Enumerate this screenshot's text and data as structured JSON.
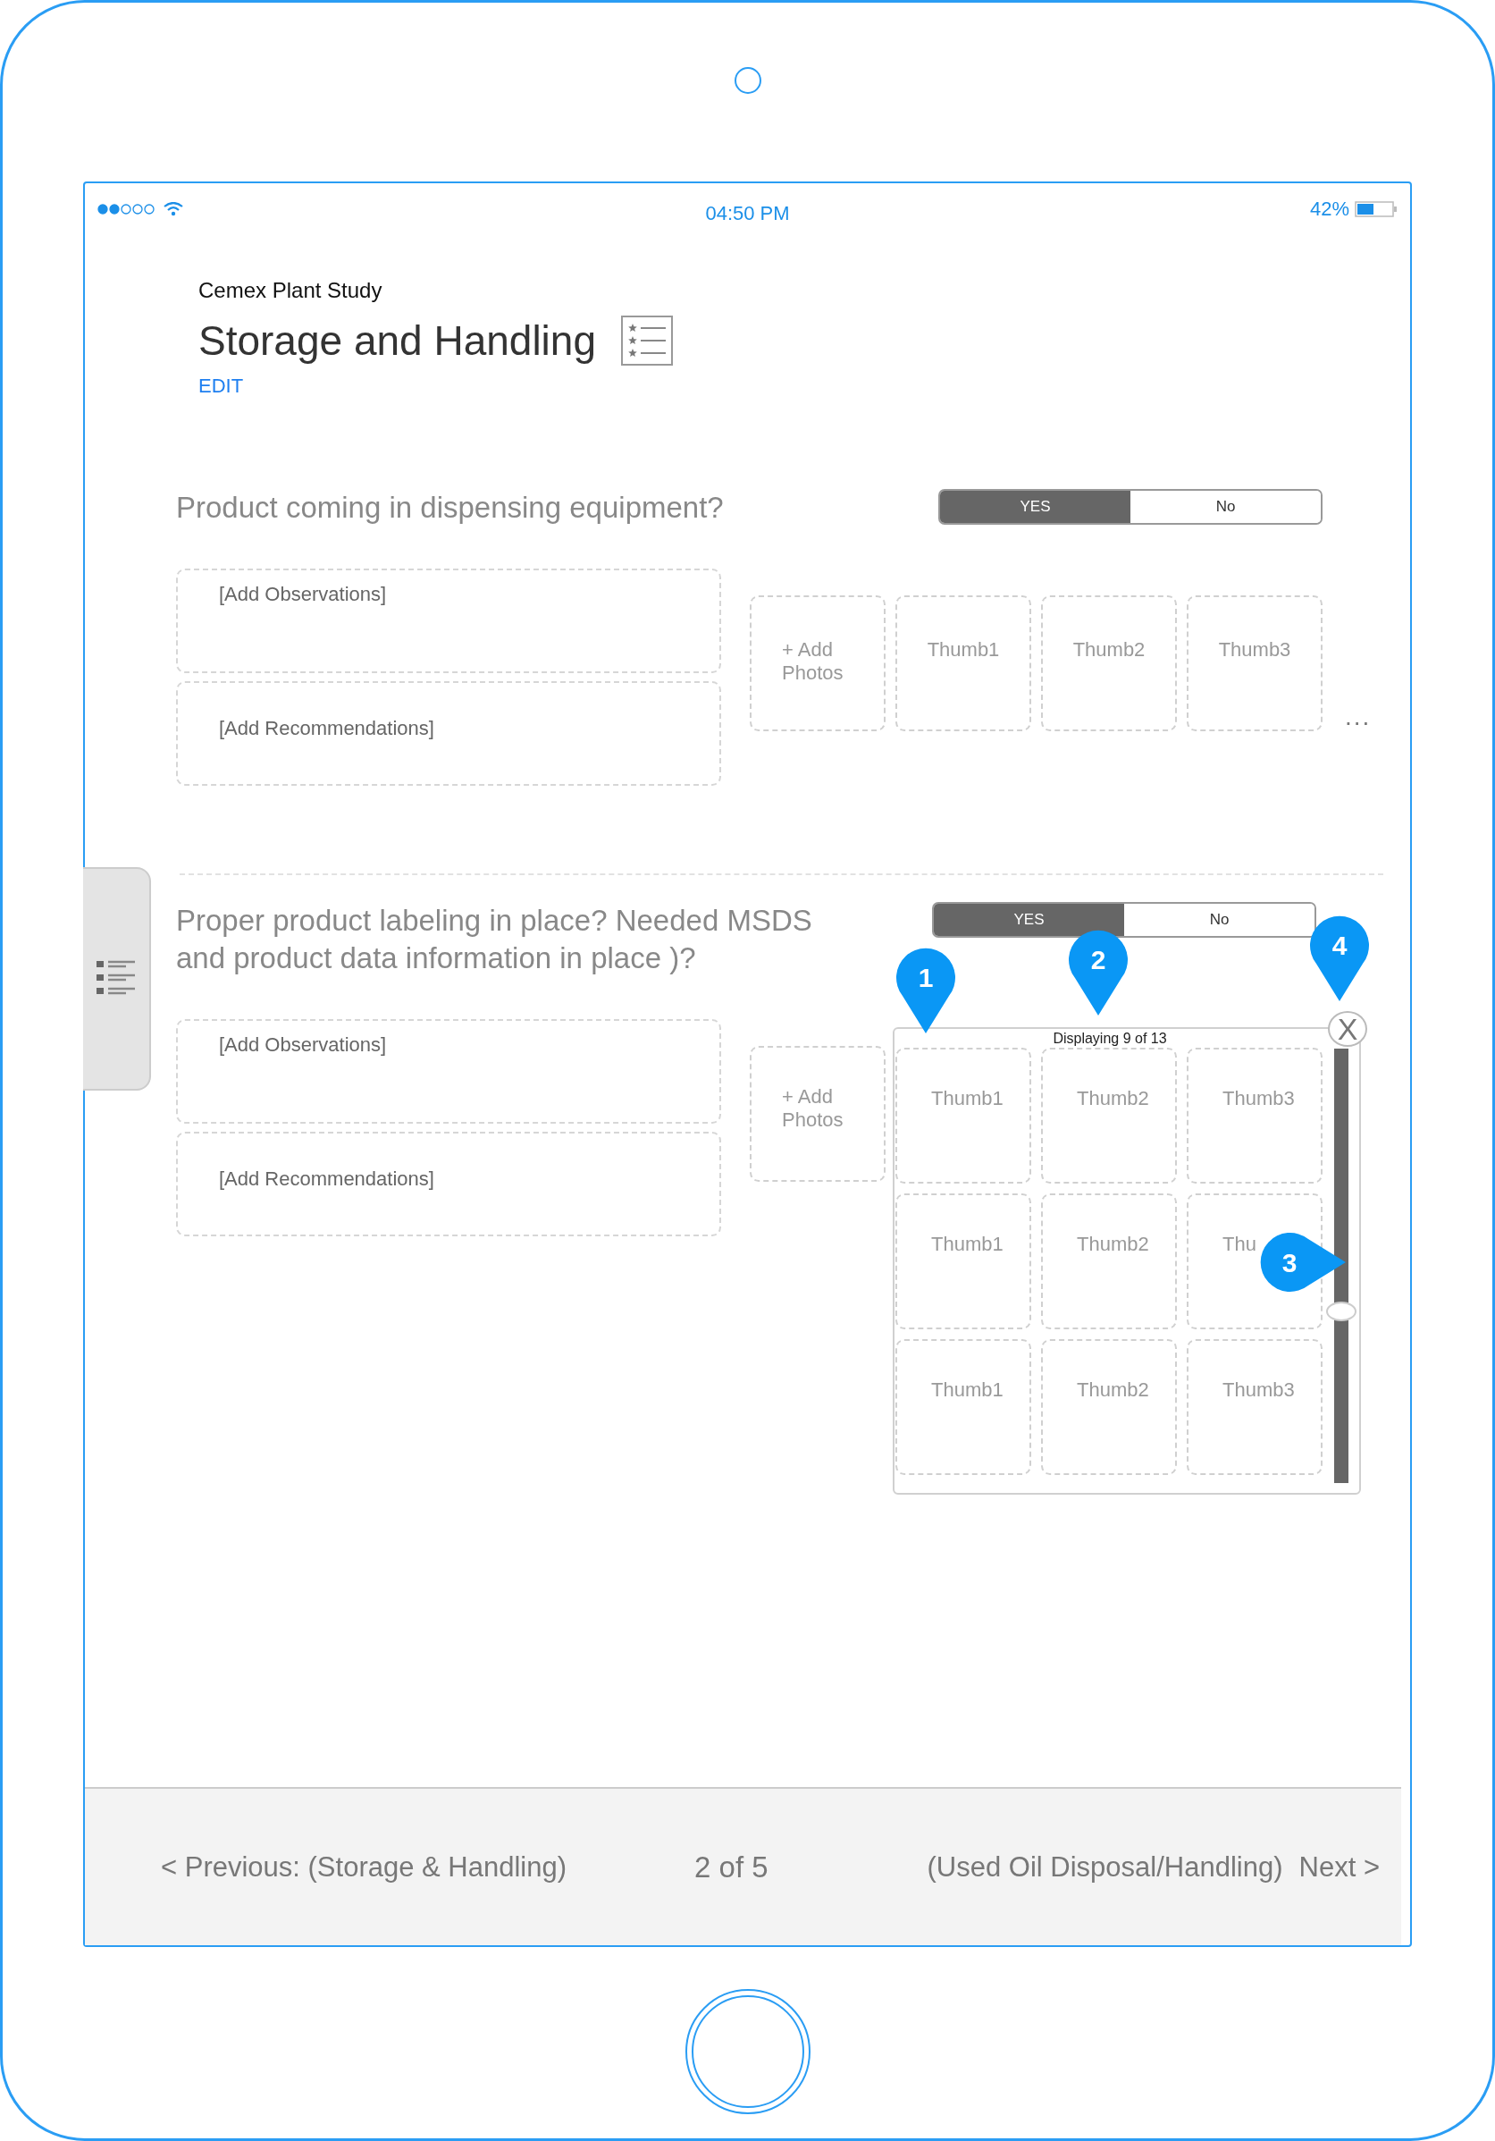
{
  "status_bar": {
    "time": "04:50 PM",
    "battery": "42%"
  },
  "header": {
    "project": "Cemex Plant Study",
    "title": "Storage and Handling",
    "edit": "EDIT"
  },
  "questions": [
    {
      "text": "Product coming in dispensing equipment?",
      "options": [
        {
          "label": "YES",
          "selected": true
        },
        {
          "label": "No",
          "selected": false
        }
      ],
      "observations": {
        "placeholder": "[Add Observations]"
      },
      "recommendations": {
        "placeholder": "[Add Recommendations]"
      },
      "photos": {
        "kind": "strip",
        "add_label": "+ Add Photos",
        "thumbnails": [
          "Thumb1",
          "Thumb2",
          "Thumb3"
        ],
        "more": "..."
      }
    },
    {
      "text": "Proper product labeling in place? Needed MSDS and product data information in place )?",
      "options": [
        {
          "label": "YES",
          "selected": true
        },
        {
          "label": "No",
          "selected": false
        }
      ],
      "observations": {
        "placeholder": "[Add Observations]"
      },
      "recommendations": {
        "placeholder": "[Add Recommendations]"
      },
      "photos": {
        "kind": "gallery",
        "add_label": "+ Add Photos",
        "caption": "Displaying 9 of 13",
        "close": "X",
        "thumbnails": [
          "Thumb1",
          "Thumb2",
          "Thumb3",
          "Thumb1",
          "Thumb2",
          "Thu",
          "Thumb1",
          "Thumb2",
          "Thumb3"
        ]
      }
    }
  ],
  "callouts": [
    {
      "label": "1",
      "kind": "down"
    },
    {
      "label": "2",
      "kind": "down"
    },
    {
      "label": "3",
      "kind": "right"
    },
    {
      "label": "4",
      "kind": "down"
    }
  ],
  "footer": {
    "previous": "< Previous: (Storage & Handling)",
    "page": "2 of 5",
    "next_section": "(Used Oil Disposal/Handling)",
    "next": "Next >"
  }
}
